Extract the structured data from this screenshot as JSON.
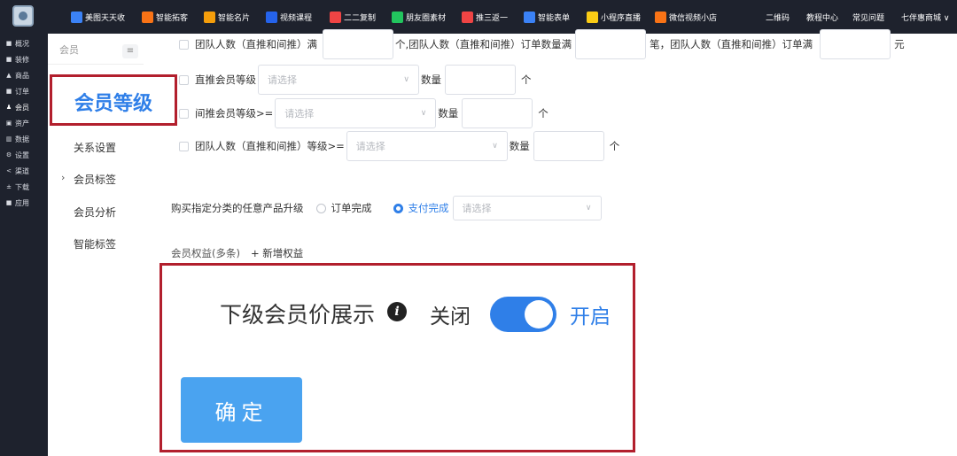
{
  "topbar": {
    "nav": [
      {
        "label": "美图天天收",
        "color": "#3b82f6"
      },
      {
        "label": "智能拓客",
        "color": "#f97316"
      },
      {
        "label": "智能名片",
        "color": "#f59e0b"
      },
      {
        "label": "视频课程",
        "color": "#2563eb"
      },
      {
        "label": "二二复制",
        "color": "#ef4444"
      },
      {
        "label": "朋友圈素材",
        "color": "#22c55e"
      },
      {
        "label": "推三返一",
        "color": "#ef4444"
      },
      {
        "label": "智能表单",
        "color": "#3b82f6"
      },
      {
        "label": "小程序直播",
        "color": "#facc15"
      },
      {
        "label": "微信视频小店",
        "color": "#f97316"
      }
    ],
    "right": [
      "二维码",
      "教程中心",
      "常见问题",
      "七伴惠商城 ∨"
    ]
  },
  "sidebar": {
    "items": [
      {
        "label": "概况",
        "icon": "■"
      },
      {
        "label": "装修",
        "icon": "■"
      },
      {
        "label": "商品",
        "icon": "▲"
      },
      {
        "label": "订单",
        "icon": "■"
      },
      {
        "label": "会员",
        "icon": "♟"
      },
      {
        "label": "资产",
        "icon": "▣"
      },
      {
        "label": "数据",
        "icon": "▥"
      },
      {
        "label": "设置",
        "icon": "⚙"
      },
      {
        "label": "渠道",
        "icon": "<"
      },
      {
        "label": "下载",
        "icon": "±"
      },
      {
        "label": "应用",
        "icon": "■"
      }
    ]
  },
  "submenu": {
    "head": "会员",
    "collapse_icon": "≡",
    "active": "会员等级",
    "items": [
      "关系设置",
      "会员标签",
      "会员分析",
      "智能标签"
    ],
    "chevron": "›"
  },
  "form": {
    "row1": {
      "a": "团队人数（直推和间推）满",
      "b": "个,团队人数（直推和间推）订单数量满",
      "c": "笔，团队人数（直推和间推）订单满",
      "d": "元"
    },
    "row2": {
      "label": "直推会员等级",
      "placeholder": "请选择",
      "qty": "数量",
      "unit": "个"
    },
    "row3": {
      "label": "间推会员等级>=",
      "placeholder": "请选择",
      "qty": "数量",
      "unit": "个"
    },
    "row4": {
      "label": "团队人数（直推和间推）等级>=",
      "placeholder": "请选择",
      "qty": "数量",
      "unit": "个"
    },
    "row5": {
      "label": "购买指定分类的任意产品升级",
      "opt1": "订单完成",
      "opt2": "支付完成",
      "placeholder": "请选择"
    },
    "benefits": {
      "label": "会员权益(多条)",
      "add": "+ 新增权益"
    }
  },
  "highlight": {
    "label": "下级会员价展示",
    "info_icon": "i",
    "off": "关闭",
    "on": "开启",
    "toggle_on": true,
    "confirm": "确定"
  }
}
